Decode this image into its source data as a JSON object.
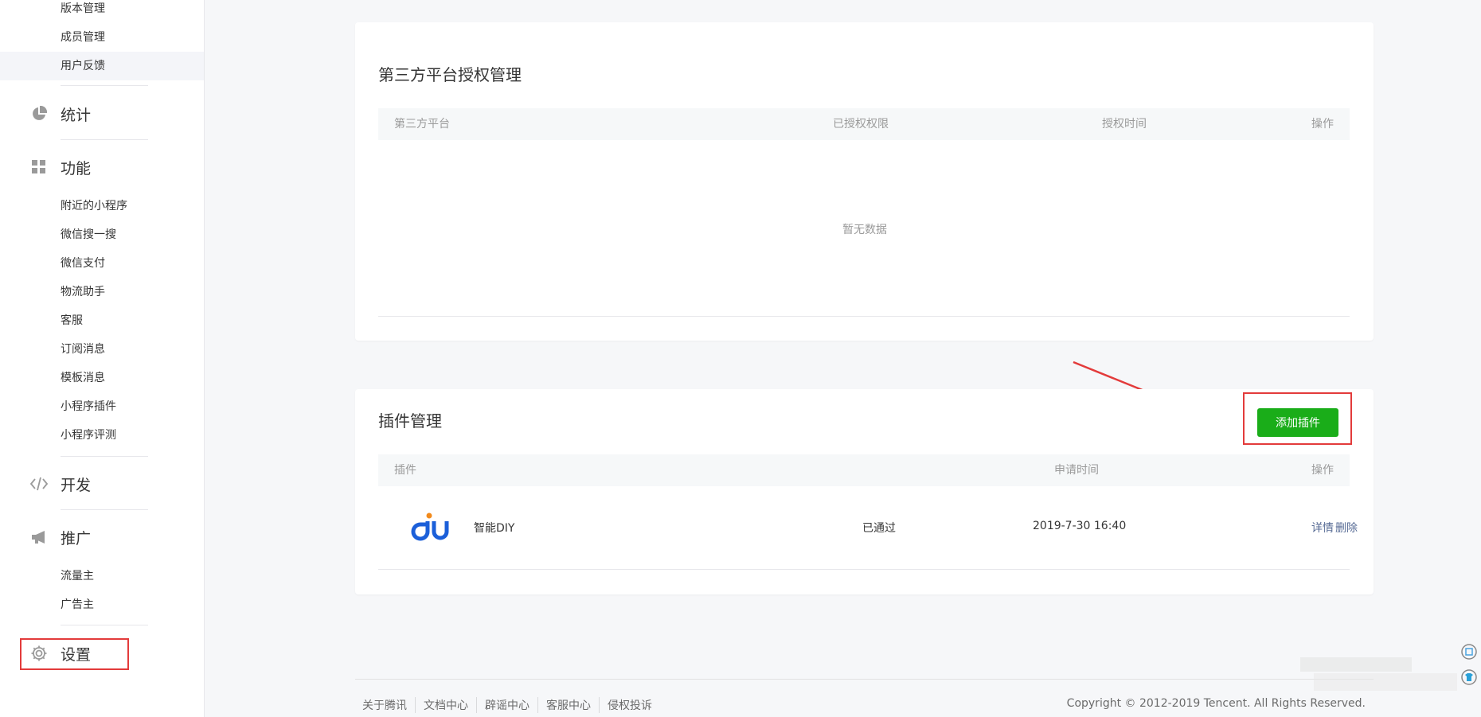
{
  "sidebar": {
    "top_items": [
      "版本管理",
      "成员管理",
      "用户反馈"
    ],
    "stats_label": "统计",
    "features_label": "功能",
    "feature_items": [
      "附近的小程序",
      "微信搜一搜",
      "微信支付",
      "物流助手",
      "客服",
      "订阅消息",
      "模板消息",
      "小程序插件",
      "小程序评测"
    ],
    "dev_label": "开发",
    "promo_label": "推广",
    "promo_items": [
      "流量主",
      "广告主"
    ],
    "settings_label": "设置"
  },
  "third_party": {
    "title": "第三方平台授权管理",
    "columns": [
      "第三方平台",
      "已授权权限",
      "授权时间",
      "操作"
    ],
    "empty_text": "暂无数据"
  },
  "plugins": {
    "title": "插件管理",
    "add_button": "添加插件",
    "columns": [
      "插件",
      "申请时间",
      "操作"
    ],
    "rows": [
      {
        "name": "智能DIY",
        "status": "已通过",
        "time": "2019-7-30 16:40",
        "action_detail": "详情",
        "action_delete": "删除"
      }
    ]
  },
  "footer": {
    "links": [
      "关于腾讯",
      "文档中心",
      "辟谣中心",
      "客服中心",
      "侵权投诉"
    ],
    "copyright": "Copyright © 2012-2019 Tencent. All Rights Reserved."
  },
  "colors": {
    "primary_button": "#1aad19",
    "link": "#576b95",
    "highlight_box": "#e33b3b",
    "logo_blue": "#1b5fd9",
    "logo_orange": "#f28a1c"
  }
}
